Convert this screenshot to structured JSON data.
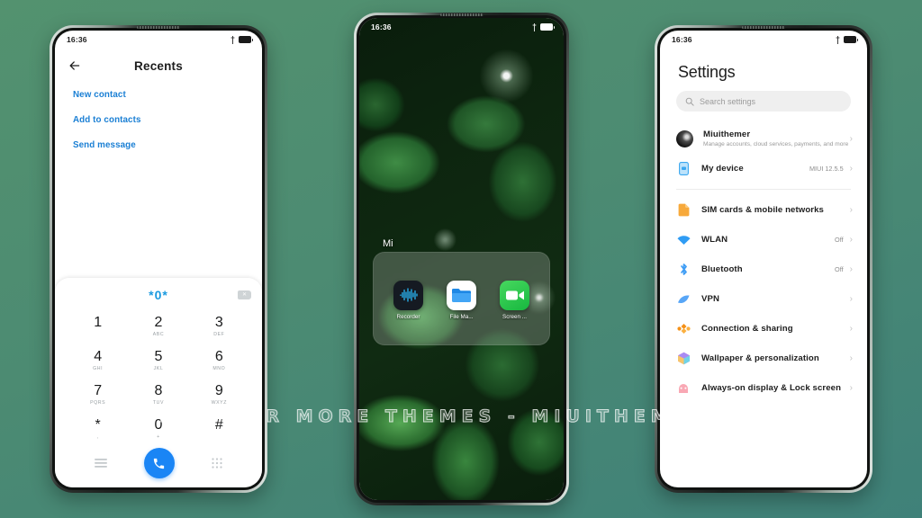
{
  "background": {
    "color_top": "#53926f",
    "color_bottom": "#3f8179"
  },
  "watermark": {
    "text": "VISIT  FOR MORE THEMES - MIUITHEMER.COM"
  },
  "phone_left": {
    "statusbar": {
      "time": "16:36",
      "icons": [
        "location-icon",
        "battery-icon"
      ]
    },
    "dialer": {
      "back_icon": "back-arrow-icon",
      "title": "Recents",
      "links": [
        {
          "label": "New contact"
        },
        {
          "label": "Add to contacts"
        },
        {
          "label": "Send message"
        }
      ],
      "number_display": "*0*",
      "backspace_icon": "backspace-icon",
      "keys": [
        {
          "digit": "1",
          "sub": ""
        },
        {
          "digit": "2",
          "sub": "ABC"
        },
        {
          "digit": "3",
          "sub": "DEF"
        },
        {
          "digit": "4",
          "sub": "GHI"
        },
        {
          "digit": "5",
          "sub": "JKL"
        },
        {
          "digit": "6",
          "sub": "MNO"
        },
        {
          "digit": "7",
          "sub": "PQRS"
        },
        {
          "digit": "8",
          "sub": "TUV"
        },
        {
          "digit": "9",
          "sub": "WXYZ"
        },
        {
          "digit": "*",
          "sub": ","
        },
        {
          "digit": "0",
          "sub": "+"
        },
        {
          "digit": "#",
          "sub": ""
        }
      ],
      "bottom_bar": {
        "left_icon": "list-menu-icon",
        "call_icon": "phone-call-icon",
        "right_icon": "keypad-grid-icon",
        "call_color": "#1a85f5"
      }
    }
  },
  "phone_center": {
    "statusbar": {
      "time": "16:36",
      "icons": [
        "location-icon",
        "battery-icon"
      ]
    },
    "folder": {
      "name": "Mi",
      "apps": [
        {
          "label": "Recorder",
          "icon": "recorder-icon"
        },
        {
          "label": "File Ma...",
          "icon": "file-manager-icon"
        },
        {
          "label": "Screen ...",
          "icon": "screen-recorder-icon"
        }
      ]
    }
  },
  "phone_right": {
    "statusbar": {
      "time": "16:36",
      "icons": [
        "location-icon",
        "battery-icon"
      ]
    },
    "settings": {
      "title": "Settings",
      "search": {
        "placeholder": "Search settings",
        "icon": "search-icon"
      },
      "account": {
        "name": "Miuithemer",
        "subtitle": "Manage accounts, cloud services, payments, and more",
        "avatar": "user-avatar"
      },
      "rows": [
        {
          "label": "My device",
          "value": "MIUI 12.5.5",
          "icon": "device-icon",
          "color": "#3ba7f0"
        },
        {
          "label": "SIM cards & mobile networks",
          "value": "",
          "icon": "sim-card-icon",
          "color": "#f5a623"
        },
        {
          "label": "WLAN",
          "value": "Off",
          "icon": "wifi-icon",
          "color": "#2f9cf4"
        },
        {
          "label": "Bluetooth",
          "value": "Off",
          "icon": "bluetooth-icon",
          "color": "#3e9df5"
        },
        {
          "label": "VPN",
          "value": "",
          "icon": "vpn-icon",
          "color": "#58a6f7"
        },
        {
          "label": "Connection & sharing",
          "value": "",
          "icon": "connection-sharing-icon",
          "color": "#f59118"
        },
        {
          "label": "Wallpaper & personalization",
          "value": "",
          "icon": "wallpaper-icon",
          "color": "#8e7bf0"
        },
        {
          "label": "Always-on display & Lock screen",
          "value": "",
          "icon": "lock-screen-icon",
          "color": "#f58a9a"
        }
      ]
    }
  }
}
